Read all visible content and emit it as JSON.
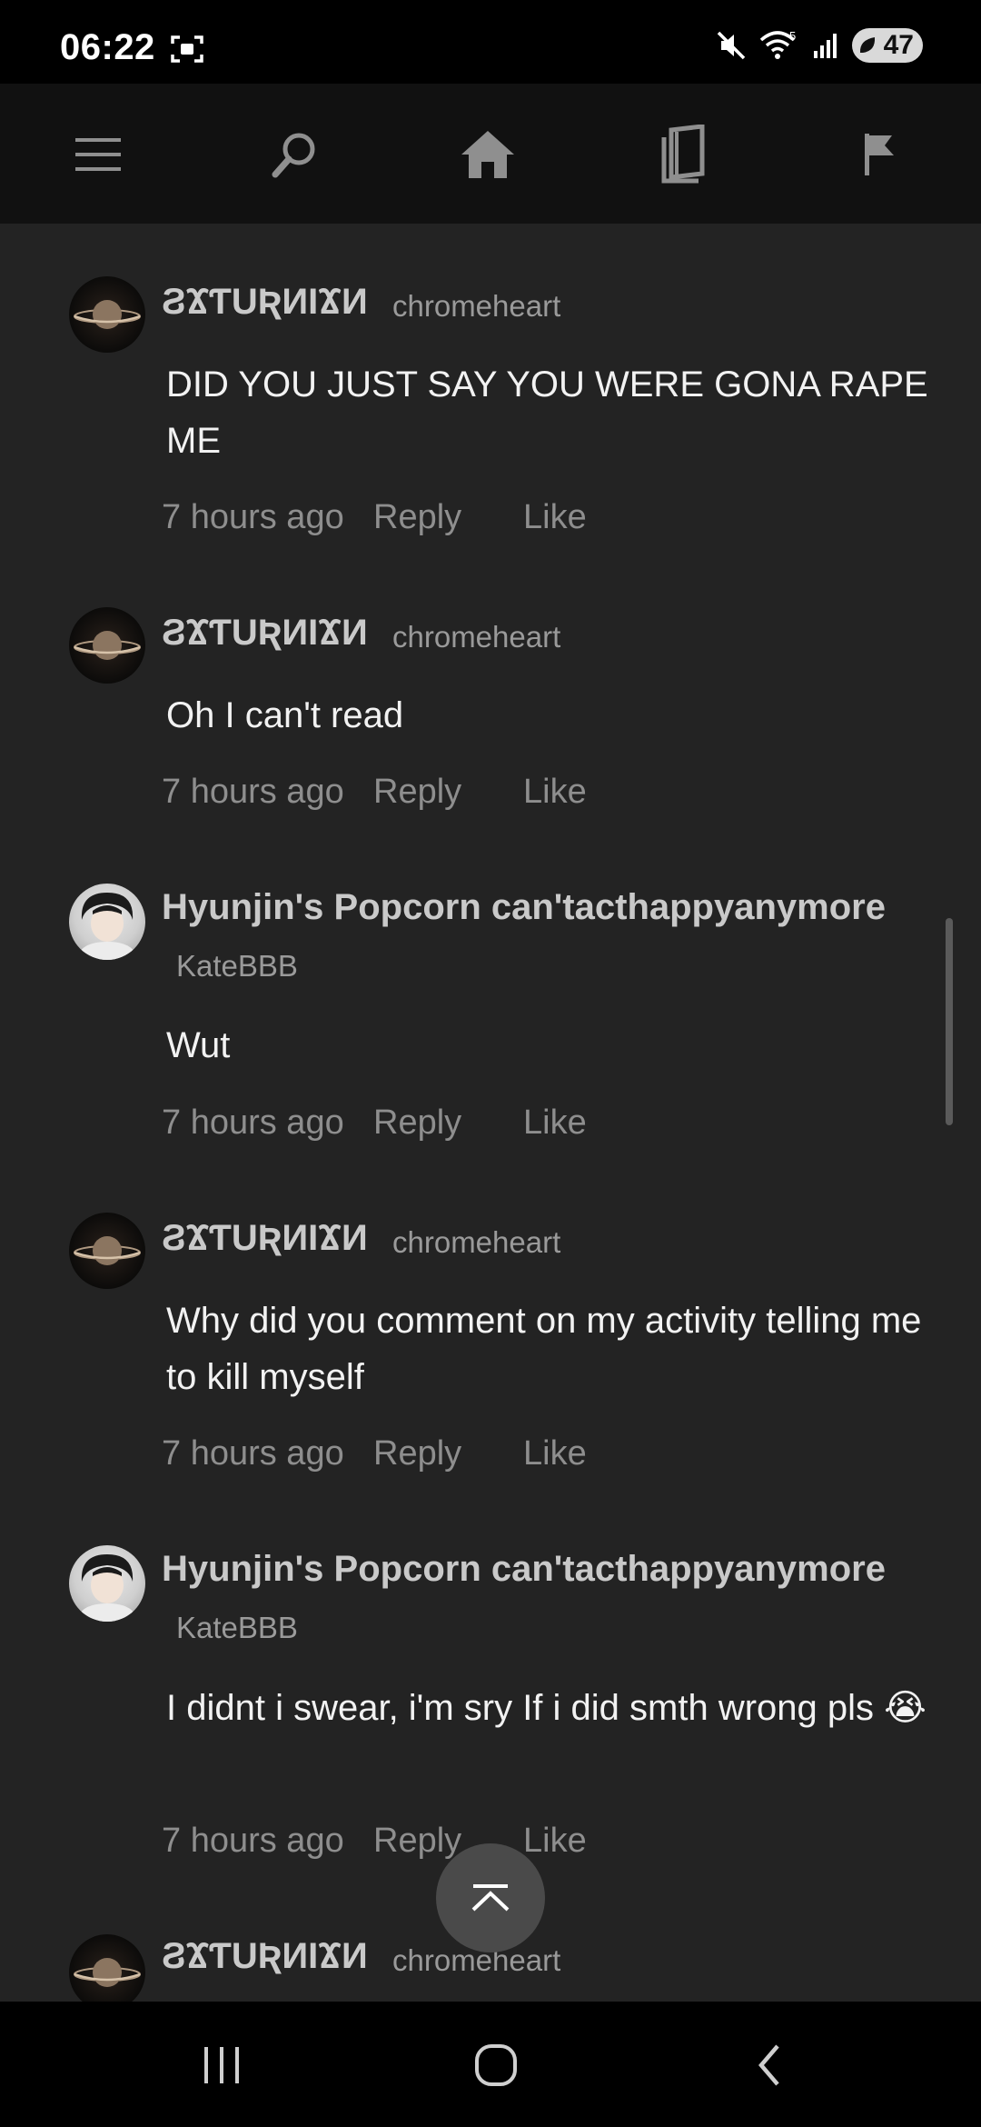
{
  "status_bar": {
    "time": "06:22",
    "battery": "47",
    "network_badge": "5"
  },
  "nav": {
    "items": [
      {
        "icon": "menu-icon"
      },
      {
        "icon": "search-icon"
      },
      {
        "icon": "home-icon"
      },
      {
        "icon": "library-icon"
      },
      {
        "icon": "flag-icon"
      }
    ]
  },
  "comments": [
    {
      "username": "ϨϪƬUƦИIϪИ",
      "handle": "chromeheart",
      "text": "DID YOU JUST SAY YOU WERE GONA RAPE ME",
      "time": "7 hours ago",
      "reply": "Reply",
      "like": "Like"
    },
    {
      "username": "ϨϪƬUƦИIϪИ",
      "handle": "chromeheart",
      "text": "Oh I can't read",
      "time": "7 hours ago",
      "reply": "Reply",
      "like": "Like"
    },
    {
      "username": "Hyunjin's Popcorn can'tacthappyanymore",
      "handle": "KateBBB",
      "text": "Wut",
      "time": "7 hours ago",
      "reply": "Reply",
      "like": "Like"
    },
    {
      "username": "ϨϪƬUƦИIϪИ",
      "handle": "chromeheart",
      "text": "Why did you comment on my activity telling me to kill myself",
      "time": "7 hours ago",
      "reply": "Reply",
      "like": "Like"
    },
    {
      "username": "Hyunjin's Popcorn can'tacthappyanymore",
      "handle": "KateBBB",
      "text": "I didnt i swear, i'm sry If i did smth wrong pls 😭",
      "time": "7 hours ago",
      "reply": "Reply",
      "like": "Like"
    },
    {
      "username": "ϨϪƬUƦИIϪИ",
      "handle": "chromeheart"
    }
  ],
  "colors": {
    "background": "#232323",
    "top_nav": "#111111",
    "meta_text": "#8e8e8e"
  }
}
